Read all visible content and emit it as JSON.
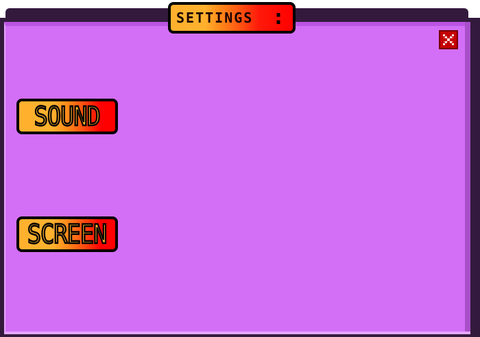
{
  "window": {
    "title": "SETTINGS",
    "title_suffix": ":"
  },
  "close_button": {
    "icon": "close-icon"
  },
  "menu": {
    "items": [
      {
        "label": "SOUND"
      },
      {
        "label": "SCREEN"
      }
    ]
  },
  "colors": {
    "panel": "#d36ff6",
    "frame": "#331a3d",
    "button_orange": "#ffb12e",
    "button_red": "#ff0000",
    "close_red": "#c40000"
  }
}
